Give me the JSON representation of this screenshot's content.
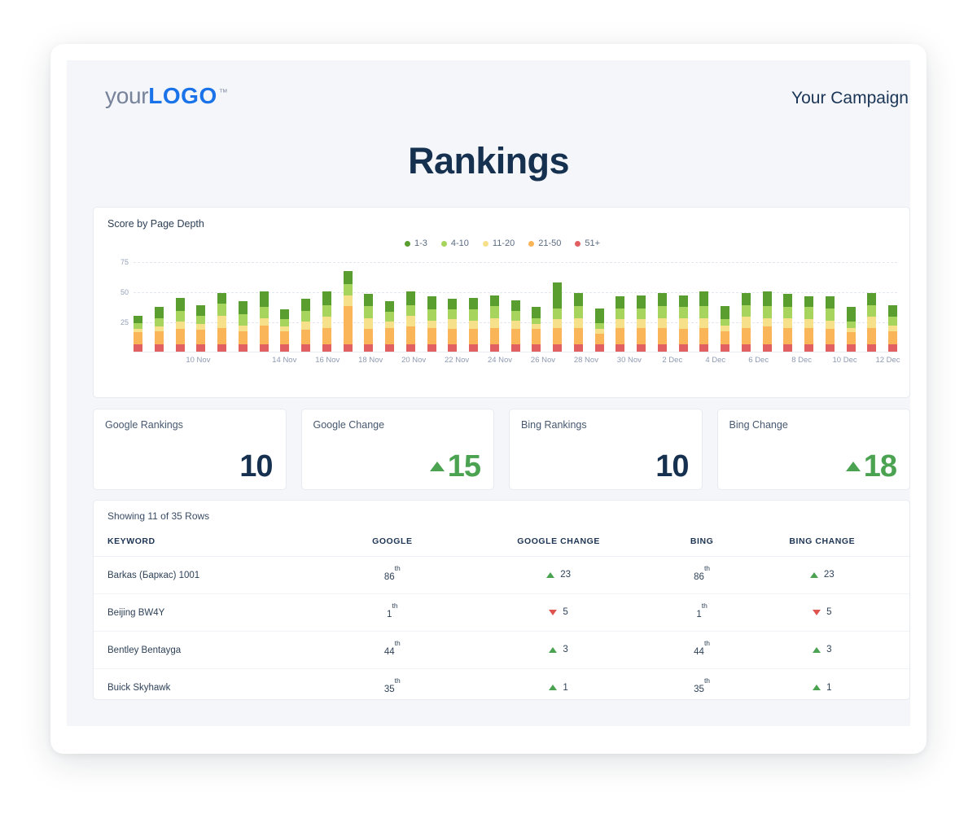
{
  "header": {
    "logo_your": "your",
    "logo_logo": "LOGO",
    "logo_tm": "™",
    "campaign": "Your Campaign"
  },
  "page_title": "Rankings",
  "chart_card": {
    "title": "Score by Page Depth"
  },
  "kpis": [
    {
      "label": "Google Rankings",
      "value": "10",
      "direction": "none"
    },
    {
      "label": "Google Change",
      "value": "15",
      "direction": "up"
    },
    {
      "label": "Bing Rankings",
      "value": "10",
      "direction": "none"
    },
    {
      "label": "Bing Change",
      "value": "18",
      "direction": "up"
    }
  ],
  "table": {
    "showing": "Showing 11 of 35 Rows",
    "columns": [
      "KEYWORD",
      "GOOGLE",
      "GOOGLE CHANGE",
      "BING",
      "BING CHANGE"
    ],
    "ordinal_suffix": "th",
    "rows": [
      {
        "keyword": "Barkas (Баркас) 1001",
        "google": "86",
        "google_sup": "th",
        "google_change": "23",
        "google_dir": "up",
        "bing": "86",
        "bing_sup": "th",
        "bing_change": "23",
        "bing_dir": "up"
      },
      {
        "keyword": "Beijing BW4Y",
        "google": "1",
        "google_sup": "th",
        "google_change": "5",
        "google_dir": "down",
        "bing": "1",
        "bing_sup": "th",
        "bing_change": "5",
        "bing_dir": "down"
      },
      {
        "keyword": "Bentley Bentayga",
        "google": "44",
        "google_sup": "th",
        "google_change": "3",
        "google_dir": "up",
        "bing": "44",
        "bing_sup": "th",
        "bing_change": "3",
        "bing_dir": "up"
      },
      {
        "keyword": "Buick Skyhawk",
        "google": "35",
        "google_sup": "th",
        "google_change": "1",
        "google_dir": "up",
        "bing": "35",
        "bing_sup": "th",
        "bing_change": "1",
        "bing_dir": "up"
      }
    ]
  },
  "colors": {
    "brand_blue": "#1a73e8",
    "navy": "#16304f",
    "up_green": "#4ba352",
    "down_red": "#e0544f",
    "page_bg": "#f4f6f9"
  },
  "chart_data": {
    "type": "bar",
    "stacked": true,
    "title": "Score by Page Depth",
    "xlabel": "",
    "ylabel": "",
    "ylim": [
      0,
      80
    ],
    "yticks": [
      25,
      50,
      75
    ],
    "grid": true,
    "legend_position": "top-center",
    "legend": [
      "1-3",
      "4-10",
      "11-20",
      "21-50",
      "51+"
    ],
    "series_colors": {
      "1-3": "#5a9e2f",
      "4-10": "#a6d45c",
      "11-20": "#f7e08a",
      "21-50": "#f9b557",
      "51+": "#e25f62"
    },
    "x_tick_labels": [
      "10 Nov",
      "14 Nov",
      "16 Nov",
      "18 Nov",
      "20 Nov",
      "22 Nov",
      "24 Nov",
      "26 Nov",
      "28 Nov",
      "30 Nov",
      "2 Dec",
      "4 Dec",
      "6 Dec",
      "8 Dec",
      "10 Dec",
      "12 Dec"
    ],
    "x_tick_indices": [
      3,
      7,
      9,
      11,
      13,
      15,
      17,
      19,
      21,
      23,
      25,
      27,
      29,
      31,
      33,
      35
    ],
    "categories": [
      "1",
      "2",
      "3",
      "4",
      "5",
      "6",
      "7",
      "8",
      "9",
      "10",
      "11",
      "12",
      "13",
      "14",
      "15",
      "16",
      "17",
      "18",
      "19",
      "20",
      "21",
      "22",
      "23",
      "24",
      "25",
      "26",
      "27",
      "28",
      "29",
      "30",
      "31",
      "32",
      "33",
      "34",
      "35",
      "36",
      "37"
    ],
    "series": [
      {
        "name": "51+",
        "values": [
          6,
          6,
          6,
          6,
          6,
          6,
          6,
          6,
          6,
          6,
          6,
          6,
          6,
          6,
          6,
          6,
          6,
          6,
          6,
          6,
          6,
          6,
          6,
          6,
          6,
          6,
          6,
          6,
          6,
          6,
          6,
          6,
          6,
          6,
          6,
          6,
          6
        ]
      },
      {
        "name": "21-50",
        "values": [
          10,
          11,
          13,
          12,
          14,
          11,
          16,
          11,
          12,
          14,
          32,
          13,
          14,
          15,
          14,
          13,
          13,
          14,
          13,
          13,
          14,
          14,
          9,
          14,
          14,
          14,
          13,
          14,
          11,
          14,
          15,
          14,
          14,
          13,
          10,
          14,
          11
        ]
      },
      {
        "name": "11-20",
        "values": [
          3,
          4,
          6,
          5,
          10,
          5,
          6,
          4,
          7,
          9,
          9,
          9,
          5,
          9,
          6,
          8,
          7,
          8,
          7,
          4,
          7,
          8,
          4,
          7,
          7,
          8,
          9,
          8,
          5,
          9,
          7,
          8,
          7,
          7,
          4,
          9,
          5
        ]
      },
      {
        "name": "4-10",
        "values": [
          5,
          7,
          9,
          7,
          10,
          9,
          9,
          6,
          9,
          10,
          9,
          10,
          8,
          9,
          9,
          8,
          9,
          10,
          8,
          5,
          9,
          10,
          5,
          9,
          9,
          10,
          9,
          10,
          5,
          10,
          10,
          9,
          10,
          10,
          5,
          10,
          7
        ]
      },
      {
        "name": "1-3",
        "values": [
          6,
          9,
          11,
          9,
          9,
          11,
          13,
          8,
          10,
          11,
          11,
          10,
          9,
          11,
          11,
          9,
          10,
          9,
          9,
          9,
          22,
          11,
          12,
          10,
          11,
          11,
          10,
          12,
          11,
          10,
          12,
          11,
          9,
          10,
          12,
          10,
          10
        ]
      }
    ]
  }
}
